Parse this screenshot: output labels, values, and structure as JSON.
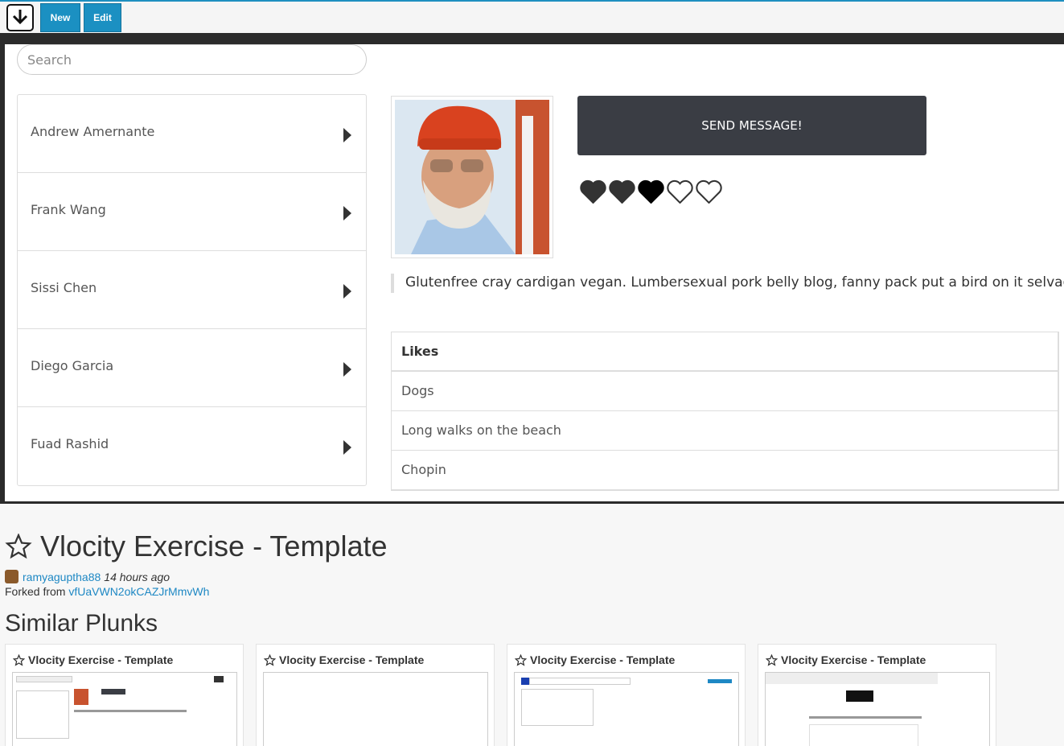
{
  "toolbar": {
    "download_icon": "download-arrow-icon",
    "new_label": "New",
    "edit_label": "Edit"
  },
  "preview": {
    "search_placeholder": "Search",
    "people": [
      {
        "name": "Andrew Amernante"
      },
      {
        "name": "Frank Wang"
      },
      {
        "name": "Sissi Chen"
      },
      {
        "name": "Diego Garcia"
      },
      {
        "name": "Fuad Rashid"
      }
    ],
    "send_button_label": "SEND MESSAGE!",
    "rating": {
      "filled": 3,
      "max": 5
    },
    "bio": "Glutenfree cray cardigan vegan. Lumbersexual pork belly blog, fanny pack put a bird on it selvage",
    "likes_header": "Likes",
    "likes": [
      "Dogs",
      "Long walks on the beach",
      "Chopin"
    ],
    "colors": {
      "button": "#3a3d44",
      "heart": "#333333"
    }
  },
  "plunk": {
    "title": "Vlocity Exercise - Template",
    "author": "ramyaguptha88",
    "time": "14 hours ago",
    "forked_prefix": "Forked from",
    "forked_from": "vfUaVWN2okCAZJrMmvWh",
    "similar_heading": "Similar Plunks",
    "cards": [
      {
        "title": "Vlocity Exercise - Template"
      },
      {
        "title": "Vlocity Exercise - Template"
      },
      {
        "title": "Vlocity Exercise - Template"
      },
      {
        "title": "Vlocity Exercise - Template"
      }
    ],
    "colors": {
      "link": "#1e88c4",
      "toolbar_button": "#1b90c2"
    }
  }
}
